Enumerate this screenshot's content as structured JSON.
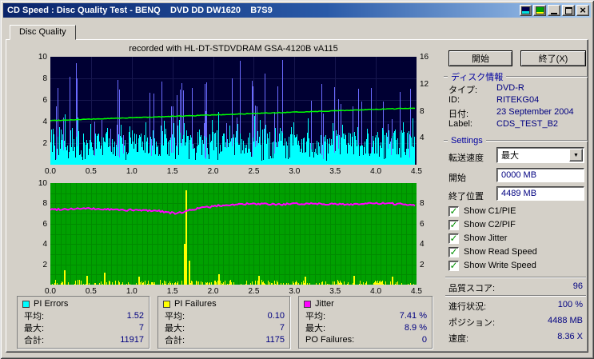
{
  "window": {
    "title": "CD Speed : Disc Quality Test - BENQ    DVD DD DW1620    B7S9"
  },
  "icons": {
    "close": "×",
    "dropdown": "▼",
    "check": "✓"
  },
  "tab": {
    "label": "Disc Quality"
  },
  "chart_header": "recorded with HL-DT-STDVDRAM GSA-4120B vA115",
  "legend": {
    "pi_errors": {
      "title": "PI Errors",
      "color": "#00ffff",
      "rows": [
        {
          "label": "平均:",
          "value": "1.52"
        },
        {
          "label": "最大:",
          "value": "7"
        },
        {
          "label": "合計:",
          "value": "11917"
        }
      ]
    },
    "pi_failures": {
      "title": "PI Failures",
      "color": "#ffff00",
      "rows": [
        {
          "label": "平均:",
          "value": "0.10"
        },
        {
          "label": "最大:",
          "value": "7"
        },
        {
          "label": "合計:",
          "value": "1175"
        }
      ]
    },
    "jitter": {
      "title": "Jitter",
      "color": "#ff00ff",
      "rows": [
        {
          "label": "平均:",
          "value": "7.41 %"
        },
        {
          "label": "最大:",
          "value": "8.9 %"
        },
        {
          "label": "PO Failures:",
          "value": "0"
        }
      ]
    }
  },
  "panel": {
    "start_button": "開始",
    "exit_button": "終了(X)",
    "disc_info": {
      "header": "ディスク情報",
      "rows": [
        {
          "label": "タイプ:",
          "value": "DVD-R"
        },
        {
          "label": "ID:",
          "value": "RITEKG04"
        },
        {
          "label": "日付:",
          "value": "23 September 2004"
        },
        {
          "label": "Label:",
          "value": "CDS_TEST_B2"
        }
      ]
    },
    "settings": {
      "header": "Settings",
      "speed_label": "転送速度",
      "speed_value": "最大",
      "start_label": "開始",
      "start_value": "0000 MB",
      "end_label": "終了位置",
      "end_value": "4489 MB",
      "checkboxes": [
        {
          "label": "Show C1/PIE",
          "checked": true
        },
        {
          "label": "Show C2/PIF",
          "checked": true
        },
        {
          "label": "Show Jitter",
          "checked": true
        },
        {
          "label": "Show Read Speed",
          "checked": true
        },
        {
          "label": "Show Write Speed",
          "checked": true
        }
      ]
    },
    "score": {
      "label": "品質スコア:",
      "value": "96"
    },
    "progress": {
      "label": "進行状況:",
      "value": "100 %"
    },
    "position": {
      "label": "ポジション:",
      "value": "4488 MB"
    },
    "speed": {
      "label": "速度:",
      "value": "8.36 X"
    }
  },
  "chart_data": [
    {
      "type": "bar",
      "title": "recorded with HL-DT-STDVDRAM GSA-4120B vA115",
      "background": "#000033",
      "grid_color": "#17174f",
      "grid_v_step": 0.5,
      "grid_h_step": 2,
      "x_axis": {
        "min": 0,
        "max": 4.5,
        "data_end": 4.48,
        "ticks": [
          "0.0",
          "0.5",
          "1.0",
          "1.5",
          "2.0",
          "2.5",
          "3.0",
          "3.5",
          "4.0",
          "4.5"
        ]
      },
      "y_left": {
        "min": 0,
        "max": 10,
        "ticks": [
          10,
          8,
          6,
          4,
          2
        ]
      },
      "y_right": {
        "min": 0,
        "max": 16,
        "ticks": [
          16,
          12,
          8,
          4
        ]
      },
      "series": [
        {
          "name": "PI Errors",
          "kind": "noise-bars",
          "color": "#00ffff",
          "spike_color": "#6b6bff",
          "seed": 42,
          "avg": 1.52,
          "max": 7,
          "total": 11917,
          "axis": "left"
        },
        {
          "name": "Read Speed",
          "kind": "line",
          "color": "#00ff00",
          "axis": "right",
          "width": 1.5,
          "noise": 0.1,
          "points": [
            [
              0,
              6.55
            ],
            [
              4.48,
              8.4
            ]
          ]
        }
      ]
    },
    {
      "type": "bar",
      "background": "#00a000",
      "grid_color": "#008a00",
      "grid_v_step": 0.0625,
      "grid_h_step": 1,
      "x_axis": {
        "min": 0,
        "max": 4.5,
        "data_end": 4.48,
        "ticks": [
          "0.0",
          "0.5",
          "1.0",
          "1.5",
          "2.0",
          "2.5",
          "3.0",
          "3.5",
          "4.0",
          "4.5"
        ]
      },
      "y_left": {
        "min": 0,
        "max": 10,
        "ticks": [
          10,
          8,
          6,
          4,
          2
        ]
      },
      "y_right": {
        "min": 0,
        "max": 10,
        "ticks": [
          8,
          6,
          4,
          2
        ]
      },
      "series": [
        {
          "name": "PI Failures",
          "kind": "noise-bars",
          "color": "#ffff00",
          "seed": 7,
          "avg": 0.1,
          "max": 7,
          "total": 1175,
          "axis": "left",
          "base_height": 0.45,
          "density": 0.5,
          "spikes": [
            [
              0.17,
              1.4
            ],
            [
              0.44,
              0.9
            ],
            [
              0.66,
              1.2
            ],
            [
              1.08,
              0.8
            ],
            [
              1.64,
              4.0
            ],
            [
              1.665,
              9.3
            ],
            [
              1.7,
              2.4
            ],
            [
              2.06,
              1.0
            ],
            [
              2.55,
              0.9
            ],
            [
              3.12,
              0.8
            ],
            [
              3.72,
              0.9
            ],
            [
              4.2,
              0.8
            ]
          ]
        },
        {
          "name": "Jitter",
          "kind": "line",
          "color": "#ff00ff",
          "axis": "right",
          "width": 2,
          "noise": 0.18,
          "avg": "7.41 %",
          "max": "8.9 %",
          "points": [
            [
              0,
              7.4
            ],
            [
              0.4,
              7.5
            ],
            [
              0.9,
              7.35
            ],
            [
              1.3,
              7.3
            ],
            [
              1.55,
              7.0
            ],
            [
              1.8,
              7.5
            ],
            [
              2.1,
              7.8
            ],
            [
              2.4,
              7.95
            ],
            [
              2.8,
              7.9
            ],
            [
              3.2,
              8.0
            ],
            [
              3.6,
              7.9
            ],
            [
              4.0,
              8.0
            ],
            [
              4.3,
              7.95
            ],
            [
              4.48,
              7.85
            ]
          ]
        }
      ]
    }
  ]
}
